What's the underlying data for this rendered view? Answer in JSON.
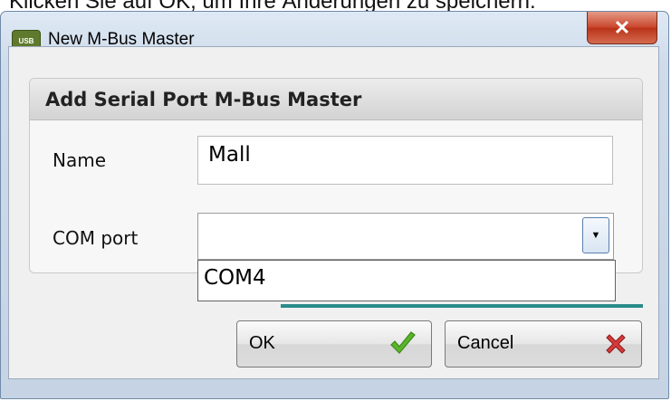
{
  "background_text": "Klicken Sie auf OK, um Ihre Änderungen zu speichern.",
  "window": {
    "title": "New M-Bus Master",
    "app_icon_label": "USB",
    "close_label": "✕"
  },
  "group": {
    "header": "Add Serial Port M-Bus Master"
  },
  "form": {
    "name_label": "Name",
    "name_value": "Mall",
    "com_label": "COM port",
    "com_value": "",
    "com_options": [
      "COM4"
    ]
  },
  "buttons": {
    "ok_label": "OK",
    "cancel_label": "Cancel"
  },
  "icons": {
    "app": "usb-app-icon",
    "close": "close-icon",
    "dropdown": "chevron-down-icon",
    "ok": "checkmark-icon",
    "cancel": "red-x-icon"
  },
  "colors": {
    "accent_line": "#2a8a8a",
    "checkmark": "#5bb52a",
    "cancel_x": "#d83a3a",
    "close_button": "#c9452c"
  }
}
